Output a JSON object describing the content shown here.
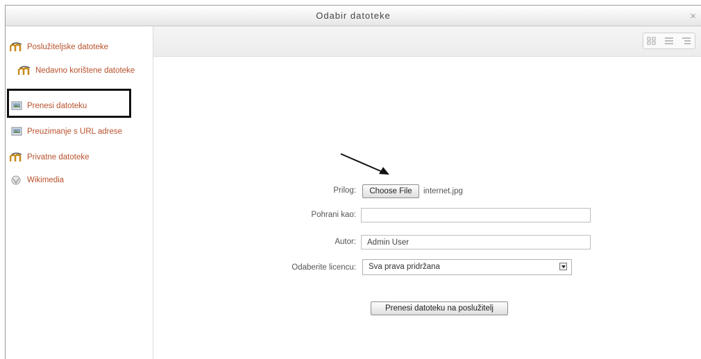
{
  "dialog": {
    "title": "Odabir datoteke",
    "close_label": "×"
  },
  "sidebar": {
    "items": [
      {
        "label": "Poslužiteljske datoteke",
        "icon": "moodle-icon"
      },
      {
        "label": "Nedavno korištene datoteke",
        "icon": "moodle-icon"
      },
      {
        "label": "Prenesi datoteku",
        "icon": "upload-icon"
      },
      {
        "label": "Preuzimanje s URL adrese",
        "icon": "upload-icon"
      },
      {
        "label": "Privatne datoteke",
        "icon": "moodle-icon"
      },
      {
        "label": "Wikimedia",
        "icon": "wikimedia-icon"
      }
    ]
  },
  "toolbar": {
    "view_buttons": [
      "icons-view-icon",
      "list-view-icon",
      "tree-view-icon"
    ]
  },
  "form": {
    "attachment_label": "Prilog:",
    "choose_file_label": "Choose File",
    "chosen_file": "internet.jpg",
    "save_as_label": "Pohrani kao:",
    "save_as_value": "",
    "author_label": "Autor:",
    "author_value": "Admin User",
    "license_label": "Odaberite licencu:",
    "license_value": "Sva prava pridržana",
    "submit_label": "Prenesi datoteku na poslužitelj"
  },
  "colors": {
    "link": "#b8502b",
    "highlight_box": "#111111"
  }
}
